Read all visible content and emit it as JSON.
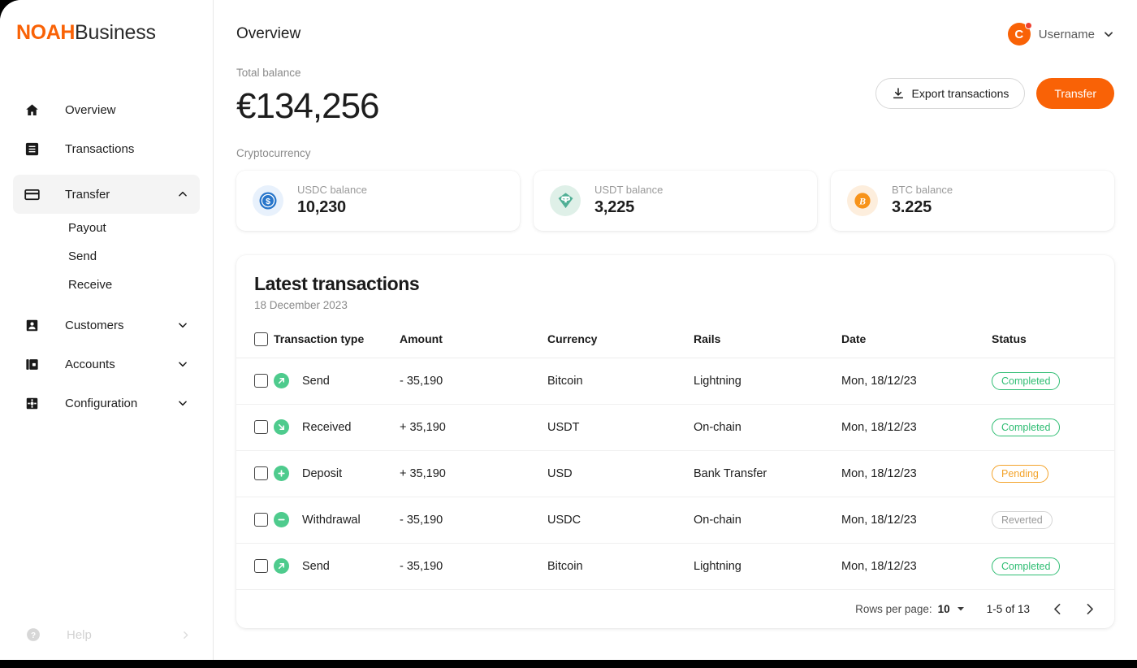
{
  "brand": {
    "primary": "NOAH",
    "secondary": "Business",
    "accent_color": "#F96206"
  },
  "sidebar": {
    "items": [
      {
        "label": "Overview",
        "icon": "home-icon"
      },
      {
        "label": "Transactions",
        "icon": "receipt-icon"
      },
      {
        "label": "Transfer",
        "icon": "card-icon",
        "expanded": true,
        "chevron": "chevron-up-icon"
      },
      {
        "label": "Customers",
        "icon": "user-icon",
        "chevron": "chevron-down-icon"
      },
      {
        "label": "Accounts",
        "icon": "wallet-icon",
        "chevron": "chevron-down-icon"
      },
      {
        "label": "Configuration",
        "icon": "gear-icon",
        "chevron": "chevron-down-icon"
      }
    ],
    "transfer_subitems": [
      {
        "label": "Payout"
      },
      {
        "label": "Send"
      },
      {
        "label": "Receive"
      }
    ],
    "help": {
      "label": "Help",
      "icon": "question-circle-icon",
      "chevron": "chevron-right-icon"
    }
  },
  "header": {
    "title": "Overview",
    "user": {
      "name": "Username",
      "avatar_initial": "C",
      "has_notification": true,
      "chevron": "chevron-down-icon"
    }
  },
  "balance": {
    "label": "Total balance",
    "value": "€134,256",
    "crypto_label": "Cryptocurrency"
  },
  "actions": {
    "export_label": "Export transactions",
    "export_icon": "download-icon",
    "transfer_label": "Transfer"
  },
  "crypto_cards": [
    {
      "name": "USDC balance",
      "amount": "10,230",
      "icon": "usdc-icon",
      "color": "#2775CA"
    },
    {
      "name": "USDT balance",
      "amount": "3,225",
      "icon": "usdt-icon",
      "color": "#50AF95"
    },
    {
      "name": "BTC balance",
      "amount": "3.225",
      "icon": "btc-icon",
      "color": "#F7931A"
    }
  ],
  "transactions": {
    "title": "Latest transactions",
    "date": "18 December 2023",
    "columns": [
      "Transaction type",
      "Amount",
      "Currency",
      "Rails",
      "Date",
      "Status"
    ],
    "rows": [
      {
        "type": "Send",
        "icon": "arrow-up-right-icon",
        "amount": "- 35,190",
        "currency": "Bitcoin",
        "rails": "Lightning",
        "date": "Mon, 18/12/23",
        "status": "Completed"
      },
      {
        "type": "Received",
        "icon": "arrow-down-right-icon",
        "amount": "+ 35,190",
        "currency": "USDT",
        "rails": "On-chain",
        "date": "Mon, 18/12/23",
        "status": "Completed"
      },
      {
        "type": "Deposit",
        "icon": "plus-icon",
        "amount": "+ 35,190",
        "currency": "USD",
        "rails": "Bank Transfer",
        "date": "Mon, 18/12/23",
        "status": "Pending"
      },
      {
        "type": "Withdrawal",
        "icon": "minus-icon",
        "amount": "- 35,190",
        "currency": "USDC",
        "rails": "On-chain",
        "date": "Mon, 18/12/23",
        "status": "Reverted"
      },
      {
        "type": "Send",
        "icon": "arrow-up-right-icon",
        "amount": "- 35,190",
        "currency": "Bitcoin",
        "rails": "Lightning",
        "date": "Mon, 18/12/23",
        "status": "Completed"
      }
    ],
    "footer": {
      "rows_per_page_label": "Rows per page:",
      "rows_per_page_value": "10",
      "rows_per_page_chevron": "chevron-down-icon",
      "range": "1-5 of 13",
      "prev_icon": "chevron-left-icon",
      "next_icon": "chevron-right-icon"
    }
  }
}
